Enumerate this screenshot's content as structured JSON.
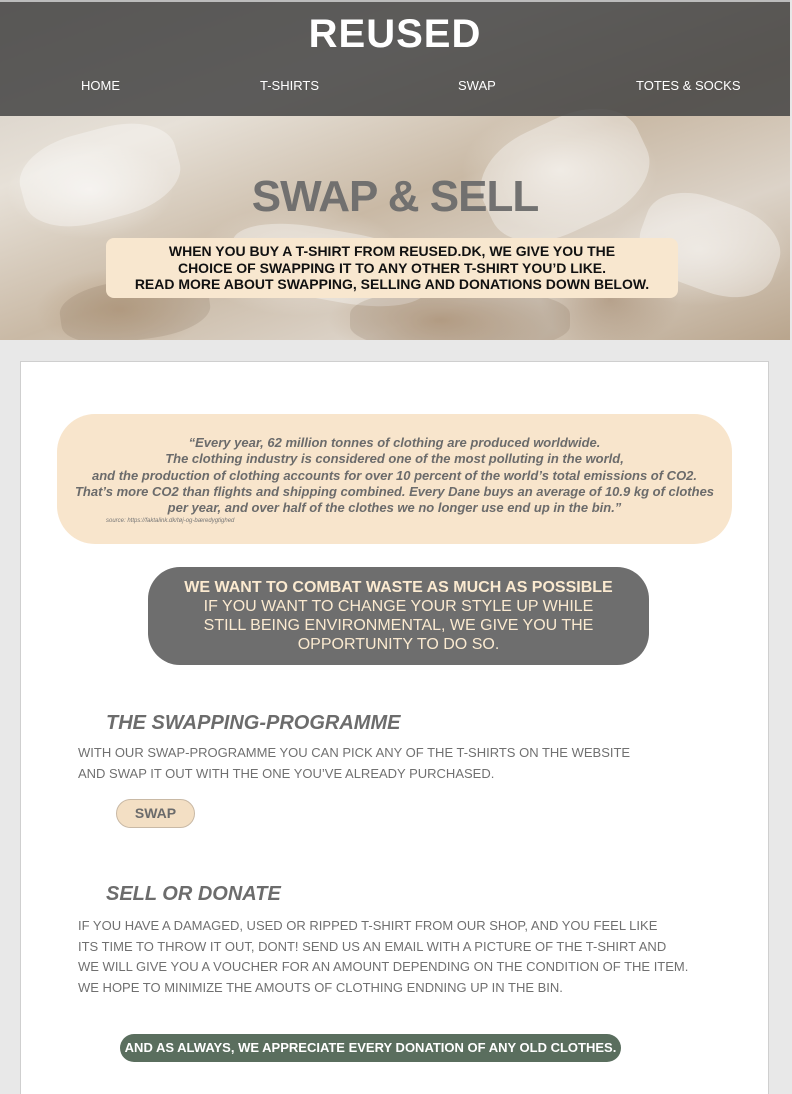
{
  "header": {
    "logo": "REUSED",
    "nav": [
      "HOME",
      "T-SHIRTS",
      "SWAP",
      "TOTES & SOCKS"
    ]
  },
  "hero": {
    "title": "SWAP & SELL",
    "intro_lines": [
      "WHEN YOU BUY A T-SHIRT FROM REUSED.DK, WE GIVE YOU THE",
      "CHOICE OF SWAPPING IT TO ANY OTHER T-SHIRT YOU’D LIKE.",
      "READ MORE ABOUT SWAPPING, SELLING AND DONATIONS DOWN BELOW."
    ]
  },
  "quote": {
    "lines": [
      "“Every year, 62 million tonnes of clothing are produced worldwide.",
      "The clothing industry is considered one of the most polluting in the world,",
      "and the production of clothing accounts for over 10 percent of the world’s total emissions of CO2.",
      "That’s more CO2 than flights and shipping combined. Every Dane buys an average of 10.9 kg of clothes",
      "per year, and over half of the clothes we no longer use end up in the bin.”"
    ],
    "source": "source: https://faktalink.dk/tøj-og-bæredygtighed"
  },
  "combat": {
    "heading": "WE WANT TO COMBAT WASTE AS MUCH AS POSSIBLE",
    "lines": [
      "IF YOU WANT TO CHANGE YOUR STYLE UP WHILE",
      "STILL BEING ENVIRONMENTAL, WE GIVE YOU THE",
      "OPPORTUNITY TO DO SO."
    ]
  },
  "swapping": {
    "title": "THE SWAPPING-PROGRAMME",
    "lines": [
      "WITH OUR SWAP-PROGRAMME YOU CAN PICK ANY OF THE T-SHIRTS ON THE WEBSITE",
      "AND SWAP IT OUT WITH THE ONE YOU’VE ALREADY PURCHASED."
    ],
    "button": "SWAP"
  },
  "sell": {
    "title": "SELL OR DONATE",
    "lines": [
      "IF YOU HAVE A DAMAGED, USED OR RIPPED T-SHIRT FROM OUR SHOP, AND YOU FEEL LIKE",
      "ITS TIME TO THROW IT OUT, DONT! SEND US AN EMAIL WITH A PICTURE OF THE T-SHIRT AND",
      "WE WILL GIVE YOU A VOUCHER FOR AN AMOUNT DEPENDING ON THE CONDITION OF THE ITEM.",
      "WE HOPE TO MINIMIZE THE AMOUTS OF CLOTHING ENDNING UP IN THE BIN."
    ],
    "donate_note": "AND AS ALWAYS, WE APPRECIATE EVERY DONATION OF ANY OLD CLOTHES."
  },
  "colors": {
    "header_bg": "#424242",
    "cream": "#f8e5cc",
    "dark_pill": "#6e6e6e",
    "green_pill": "#5a6e5e"
  }
}
